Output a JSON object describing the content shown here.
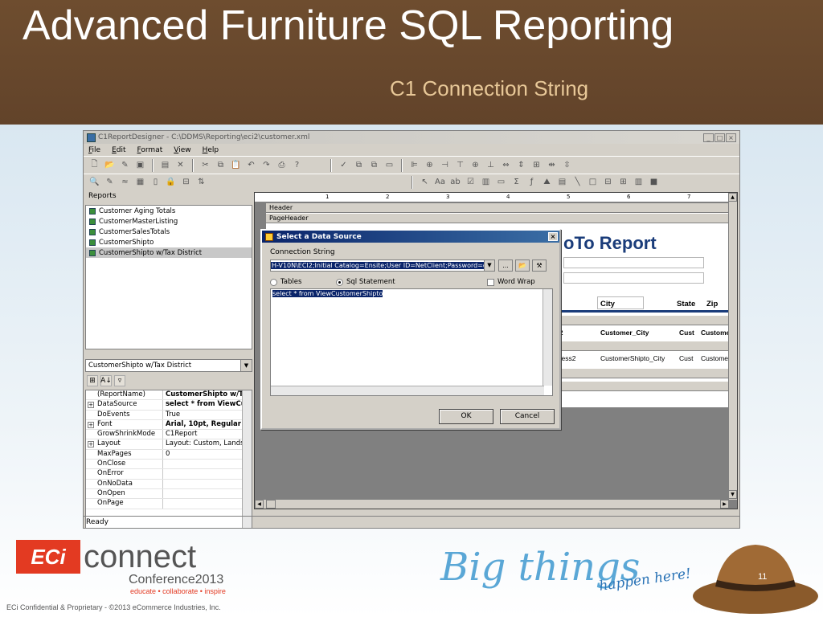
{
  "slide": {
    "title": "Advanced Furniture SQL Reporting",
    "subtitle": "C1 Connection String",
    "page_number": "11",
    "copyright": "ECi Confidential & Proprietary - ©2013 eCommerce Industries, Inc."
  },
  "branding": {
    "eci": "ECi",
    "connect": "connect",
    "conference": "Conference2013",
    "tagline": "educate • collaborate • inspire",
    "big_things": "Big things",
    "happen_here": "happen here!"
  },
  "app": {
    "title": "C1ReportDesigner - C:\\DDMS\\Reporting\\eci2\\customer.xml",
    "menu": [
      "File",
      "Edit",
      "Format",
      "View",
      "Help"
    ],
    "status": "Ready",
    "reports_label": "Reports",
    "reports": [
      "Customer Aging Totals",
      "CustomerMasterListing",
      "CustomerSalesTotals",
      "CustomerShipto",
      "CustomerShipto w/Tax District"
    ],
    "selected_report": "CustomerShipto w/Tax District",
    "properties": [
      {
        "name": "(ReportName)",
        "value": "CustomerShipto w/Ta",
        "bold": true,
        "expand": false
      },
      {
        "name": "DataSource",
        "value": "select * from ViewCu",
        "bold": true,
        "expand": true
      },
      {
        "name": "DoEvents",
        "value": "True",
        "bold": false,
        "expand": false
      },
      {
        "name": "Font",
        "value": "Arial, 10pt, Regular",
        "bold": true,
        "expand": true
      },
      {
        "name": "GrowShrinkMode",
        "value": "C1Report",
        "bold": false,
        "expand": false
      },
      {
        "name": "Layout",
        "value": "Layout: Custom, Landsca",
        "bold": false,
        "expand": true
      },
      {
        "name": "MaxPages",
        "value": "0",
        "bold": false,
        "expand": false
      },
      {
        "name": "OnClose",
        "value": "",
        "bold": false,
        "expand": false
      },
      {
        "name": "OnError",
        "value": "",
        "bold": false,
        "expand": false
      },
      {
        "name": "OnNoData",
        "value": "",
        "bold": false,
        "expand": false
      },
      {
        "name": "OnOpen",
        "value": "",
        "bold": false,
        "expand": false
      },
      {
        "name": "OnPage",
        "value": "",
        "bold": false,
        "expand": false
      }
    ],
    "design": {
      "ruler_marks": [
        "1",
        "2",
        "3",
        "4",
        "5",
        "6",
        "7"
      ],
      "band_header": "Header",
      "band_pageheader": "PageHeader",
      "report_title": "oTo Report",
      "col_city": "City",
      "col_state": "State",
      "col_zip": "Zip",
      "grp_cust_city": "Customer_City",
      "grp_s2": "s2",
      "grp_cust": "Cust",
      "grp_custome": "Custome",
      "det_address2": "dress2",
      "det_city": "CustomerShipto_City",
      "det_cust": "Cust",
      "det_custome": "Custome"
    }
  },
  "dialog": {
    "title": "Select a Data Source",
    "conn_label": "Connection String",
    "conn_value": "H-V10N\\ECI2;Initial Catalog=Ensite;User ID=NetClient;Password=db_user",
    "radio_tables": "Tables",
    "radio_sql": "Sql Statement",
    "word_wrap": "Word Wrap",
    "sql": "select * from ViewCustomerShipto",
    "ok": "OK",
    "cancel": "Cancel"
  }
}
